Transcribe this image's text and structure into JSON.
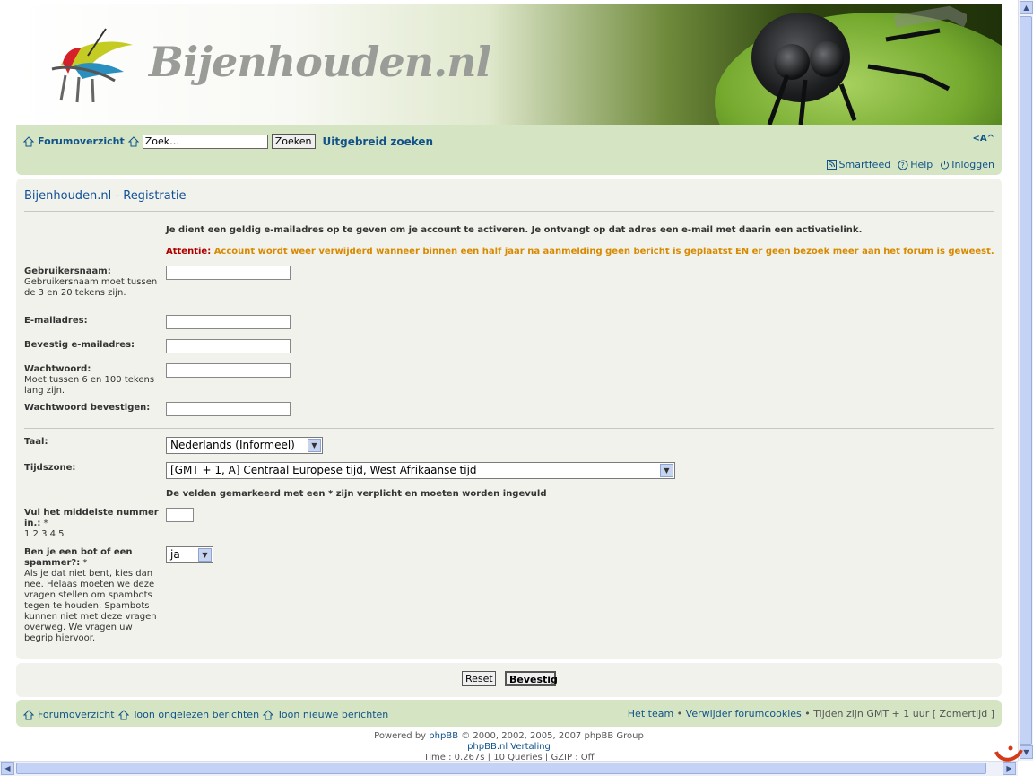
{
  "banner": {
    "logo_text": "Bijenhouden.nl"
  },
  "navbar": {
    "forum_overview": "Forumoverzicht",
    "search_placeholder": "Zoek…",
    "search_button": "Zoeken",
    "advanced_search": "Uitgebreid zoeken",
    "fontsize_label": "<A^",
    "smartfeed": "Smartfeed",
    "help": "Help",
    "login": "Inloggen"
  },
  "form": {
    "title": "Bijenhouden.nl - Registratie",
    "intro": "Je dient een geldig e-mailadres op te geven om je account te activeren. Je ontvangt op dat adres een e-mail met daarin een activatielink.",
    "attention_label": "Attentie:",
    "attention_text": "Account wordt weer verwijderd wanneer binnen een half jaar na aanmelding geen bericht is geplaatst EN er geen bezoek meer aan het forum is geweest.",
    "username_label": "Gebruikersnaam:",
    "username_help": "Gebruikersnaam moet tussen de 3 en 20 tekens zijn.",
    "email_label": "E-mailadres:",
    "email_confirm_label": "Bevestig e-mailadres:",
    "password_label": "Wachtwoord:",
    "password_help": "Moet tussen 6 en 100 tekens lang zijn.",
    "password_confirm_label": "Wachtwoord bevestigen:",
    "language_label": "Taal:",
    "language_value": "Nederlands (Informeel)",
    "timezone_label": "Tijdszone:",
    "timezone_value": "[GMT + 1, A] Centraal Europese tijd, West Afrikaanse tijd",
    "required_note": "De velden gemarkeerd met een * zijn verplicht en moeten worden ingevuld",
    "middle_label": "Vul het middelste nummer in.:",
    "middle_star": "*",
    "middle_numbers": "1 2 3 4 5",
    "bot_label": "Ben je een bot of een spammer?:",
    "bot_star": "*",
    "bot_help": "Als je dat niet bent, kies dan nee. Helaas moeten we deze vragen stellen om spambots tegen te houden. Spambots kunnen niet met deze vragen overweg. We vragen uw begrip hiervoor.",
    "bot_value": "ja",
    "reset_button": "Reset",
    "submit_button": "Bevestig"
  },
  "footer_nav": {
    "forum_overview": "Forumoverzicht",
    "unread": "Toon ongelezen berichten",
    "new_posts": "Toon nieuwe berichten",
    "team": "Het team",
    "sep": "•",
    "delete_cookies": "Verwijder forumcookies",
    "times": "Tijden zijn GMT + 1 uur [ Zomertijd ]"
  },
  "copyright": {
    "powered_by": "Powered by",
    "phpbb": "phpBB",
    "rest": "© 2000, 2002, 2005, 2007 phpBB Group",
    "translation": "phpBB.nl Vertaling",
    "stats": "Time : 0.267s | 10 Queries | GZIP : Off"
  },
  "colors": {
    "link": "#105289",
    "nav_bg": "#d5e5c4",
    "panel_bg": "#f2f2ec",
    "attention_red": "#b00000",
    "attention_orange": "#d78a00"
  }
}
